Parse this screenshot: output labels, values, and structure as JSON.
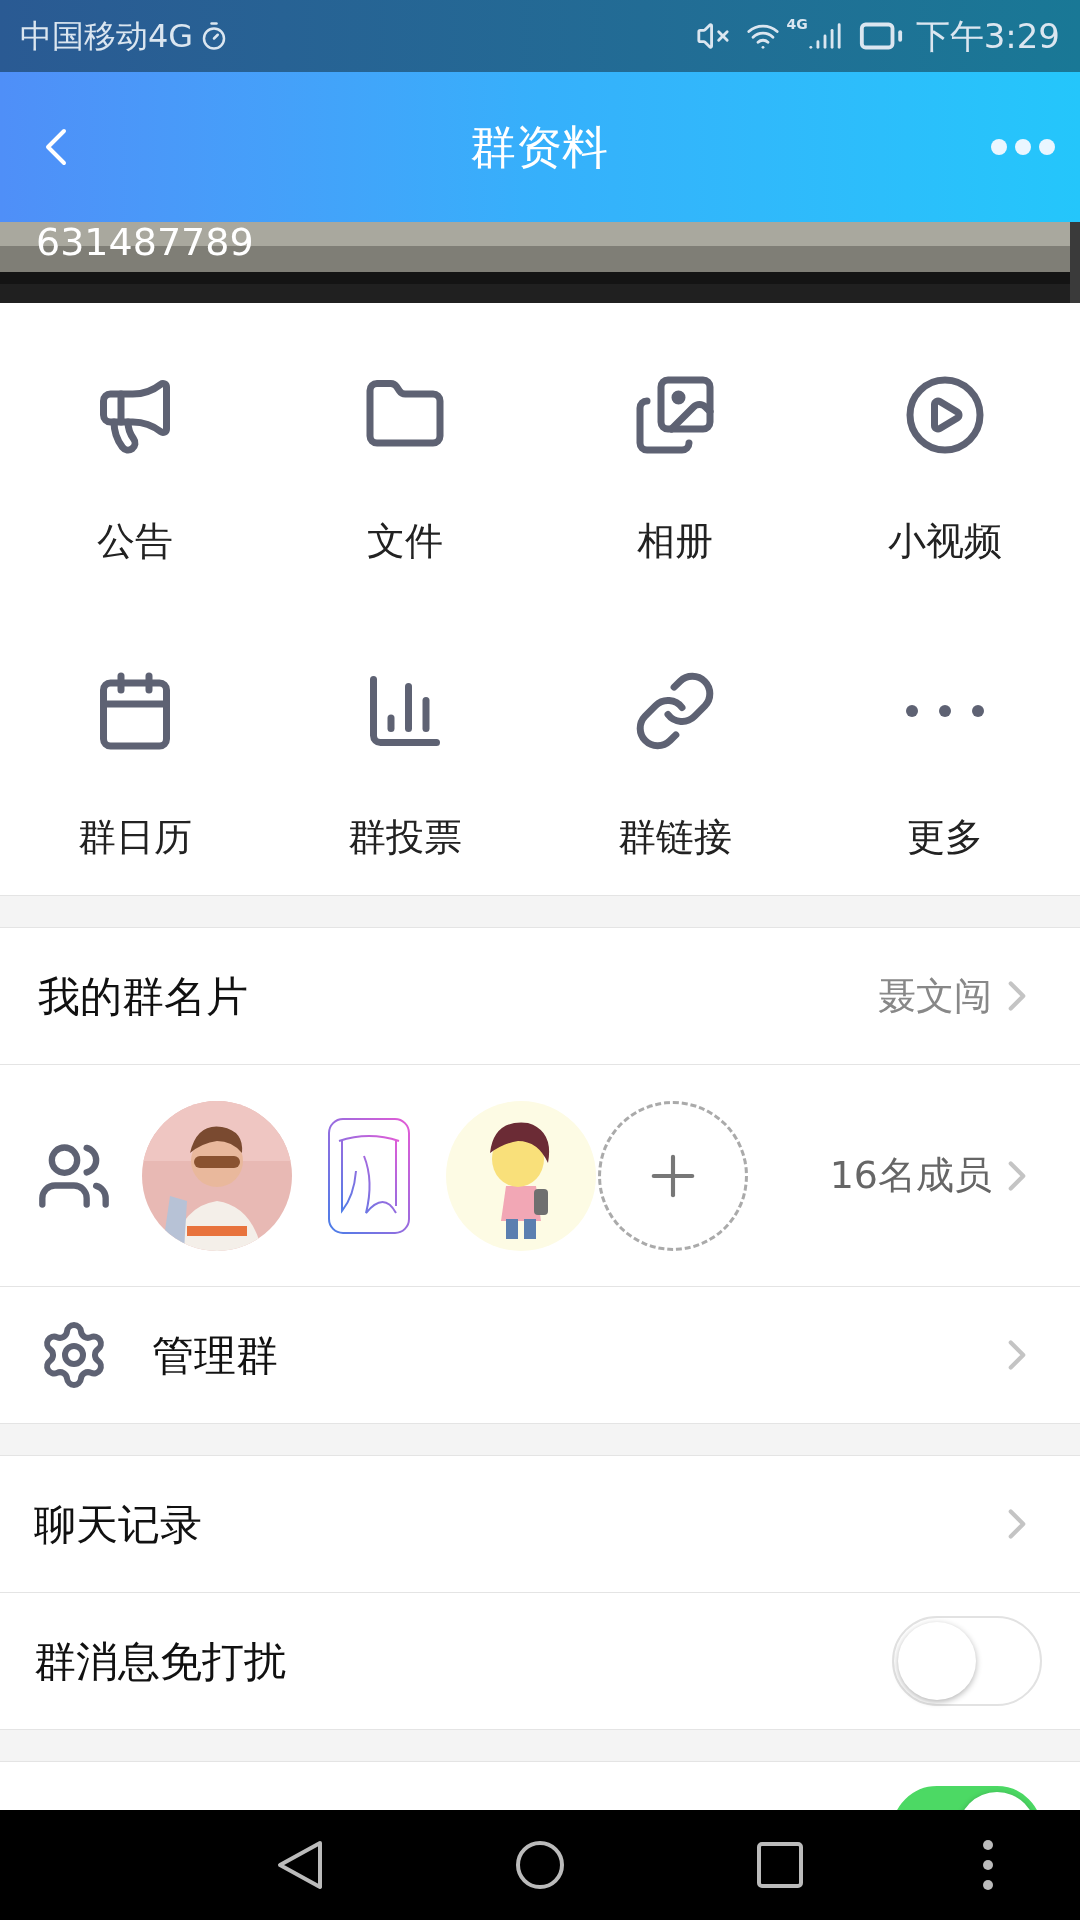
{
  "status_bar": {
    "carrier": "中国移动4G",
    "network": "4G",
    "time": "下午3:29"
  },
  "header": {
    "title": "群资料"
  },
  "banner": {
    "group_number": "631487789"
  },
  "features": [
    {
      "label": "公告"
    },
    {
      "label": "文件"
    },
    {
      "label": "相册"
    },
    {
      "label": "小视频"
    },
    {
      "label": "群日历"
    },
    {
      "label": "群投票"
    },
    {
      "label": "群链接"
    },
    {
      "label": "更多"
    }
  ],
  "group_card": {
    "label": "我的群名片",
    "value": "聂文闯"
  },
  "members": {
    "count": "16名成员"
  },
  "manage": {
    "label": "管理群"
  },
  "settings": [
    {
      "kind": "link",
      "label": "聊天记录"
    },
    {
      "kind": "toggle",
      "label": "群消息免打扰",
      "on": false
    }
  ],
  "more_settings": [
    {
      "kind": "toggle",
      "on": true
    }
  ]
}
